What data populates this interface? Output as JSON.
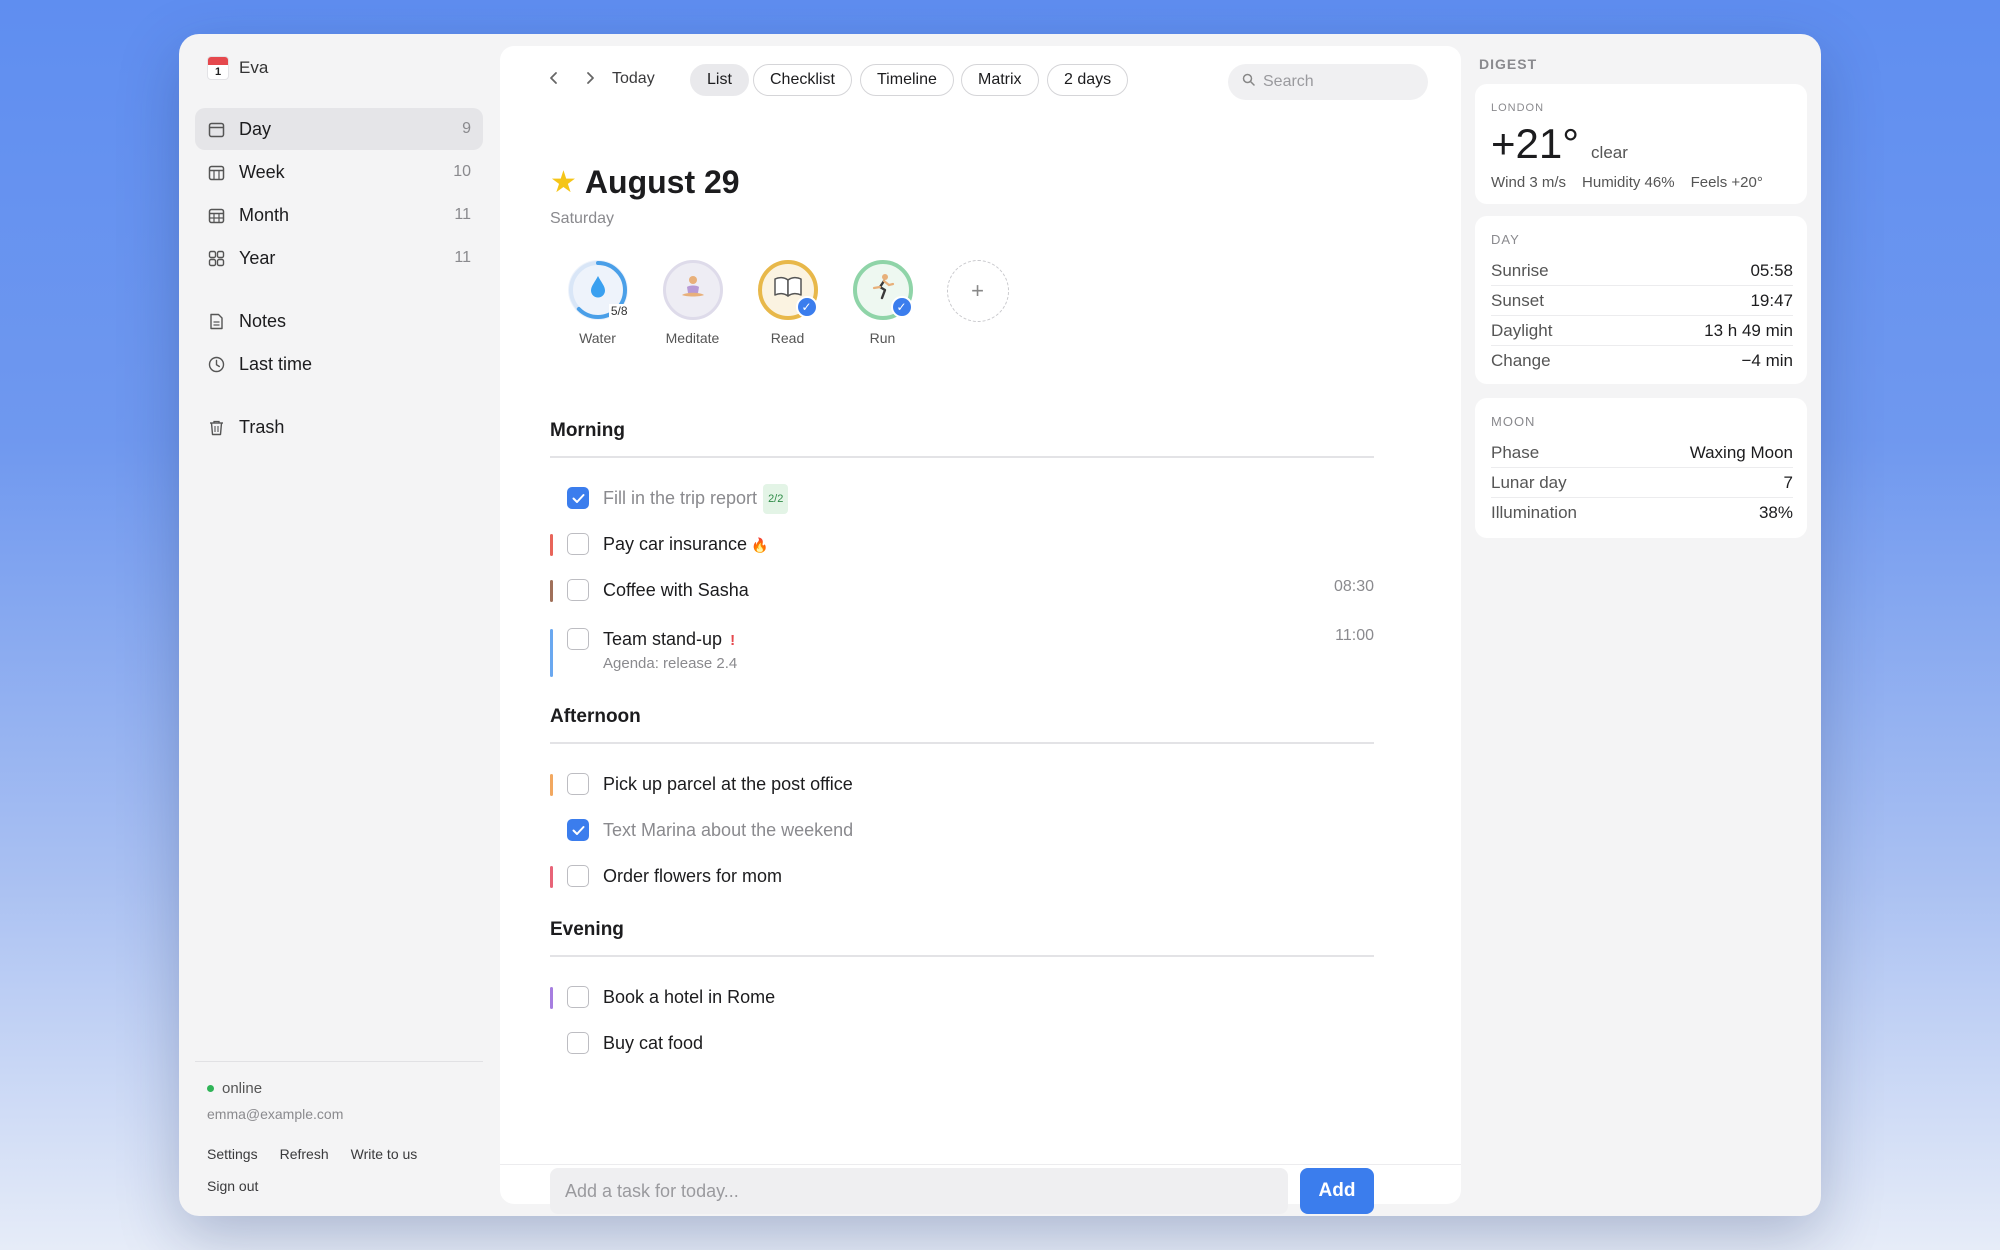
{
  "user": {
    "name": "Eva",
    "calendar_day": "1"
  },
  "nav": {
    "primary": [
      {
        "label": "Day",
        "count": "9",
        "icon": "calendar-day-icon"
      },
      {
        "label": "Week",
        "count": "10",
        "icon": "calendar-week-icon"
      },
      {
        "label": "Month",
        "count": "11",
        "icon": "calendar-month-icon"
      },
      {
        "label": "Year",
        "count": "11",
        "icon": "grid-icon"
      }
    ],
    "secondary": [
      {
        "label": "Notes",
        "icon": "note-icon"
      },
      {
        "label": "Last time",
        "icon": "clock-icon"
      }
    ],
    "trash": {
      "label": "Trash",
      "icon": "trash-icon"
    }
  },
  "account": {
    "status": "online",
    "email": "emma@example.com",
    "links": [
      "Settings",
      "Refresh",
      "Write to us",
      "Sign out"
    ]
  },
  "toolbar": {
    "today": "Today",
    "views": [
      "List",
      "Checklist",
      "Timeline",
      "Matrix",
      "2 days"
    ],
    "active_view": "List",
    "search_placeholder": "Search"
  },
  "day": {
    "title": "August 29",
    "weekday": "Saturday",
    "star_icon": "star-icon"
  },
  "habits": [
    {
      "label": "Water",
      "count": "5/8",
      "progress": 0.625,
      "icon": "water-drop-icon",
      "color": "#4a9fe8"
    },
    {
      "label": "Meditate",
      "icon": "meditate-icon",
      "color": "#d8d3e8"
    },
    {
      "label": "Read",
      "icon": "book-icon",
      "color": "#e8b84a",
      "done": true
    },
    {
      "label": "Run",
      "icon": "runner-icon",
      "color": "#8fd4a8",
      "done": true
    }
  ],
  "sections": {
    "morning": {
      "title": "Morning",
      "tasks": [
        {
          "title": "Fill in the trip report",
          "badge": "2/2",
          "done": true
        },
        {
          "title": "Pay car insurance",
          "done": false,
          "bar_color": "#e8655a",
          "fire": "🔥"
        },
        {
          "title": "Coffee with Sasha",
          "time": "08:30",
          "done": false,
          "bar_color": "#a0705a"
        },
        {
          "title": "Team stand-up",
          "sub": "Agenda: release 2.4",
          "time": "11:00",
          "flag": "!",
          "done": false,
          "bar_color": "#6aa8f0"
        }
      ]
    },
    "afternoon": {
      "title": "Afternoon",
      "tasks": [
        {
          "title": "Pick up parcel at the post office",
          "done": false,
          "bar_color": "#f2a860"
        },
        {
          "title": "Text Marina about the weekend",
          "done": true
        },
        {
          "title": "Order flowers for mom",
          "done": false,
          "bar_color": "#e86478"
        }
      ]
    },
    "evening": {
      "title": "Evening",
      "tasks": [
        {
          "title": "Book a hotel in Rome",
          "done": false,
          "bar_color": "#a67ee0"
        },
        {
          "title": "Buy cat food",
          "done": false
        }
      ]
    }
  },
  "composer": {
    "placeholder": "Add a task for today...",
    "add_label": "Add"
  },
  "digest": {
    "title": "DIGEST",
    "weather": {
      "city": "LONDON",
      "temp": "+21°",
      "condition": "clear",
      "wind": "Wind 3 m/s",
      "humidity": "Humidity 46%",
      "feels": "Feels +20°"
    },
    "day": {
      "label": "DAY",
      "rows": [
        {
          "k": "Sunrise",
          "v": "05:58"
        },
        {
          "k": "Sunset",
          "v": "19:47"
        },
        {
          "k": "Daylight",
          "v": "13 h 49 min"
        },
        {
          "k": "Change",
          "v": "−4 min"
        }
      ]
    },
    "moon": {
      "label": "MOON",
      "rows": [
        {
          "k": "Phase",
          "v": "Waxing Moon"
        },
        {
          "k": "Lunar day",
          "v": "7"
        },
        {
          "k": "Illumination",
          "v": "38%"
        }
      ]
    }
  },
  "colors": {
    "accent": "#3b7ded",
    "online": "#2fb457"
  }
}
